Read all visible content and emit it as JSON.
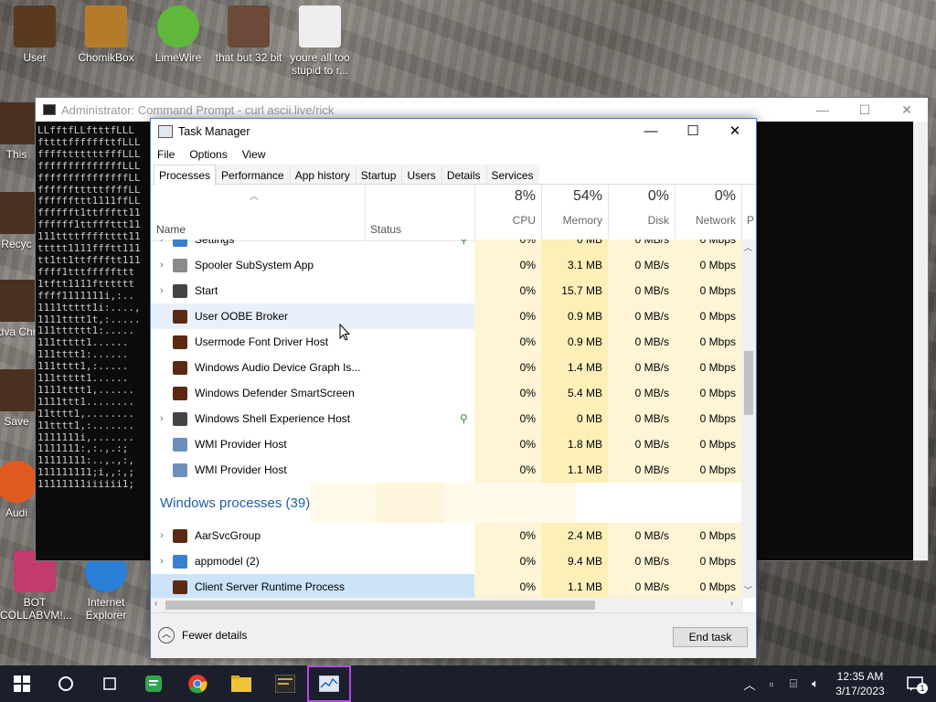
{
  "desktop": {
    "icons": [
      {
        "label": "User",
        "color": "#5a3a1e"
      },
      {
        "label": "ChomikBox",
        "color": "#b57b2a"
      },
      {
        "label": "LimeWire",
        "color": "#5fb83a"
      },
      {
        "label": "that but 32 bit",
        "color": "#6b4a3a"
      },
      {
        "label": "youre all too stupid to r...",
        "color": "#eeeeee"
      },
      {
        "label": "BOT COLLABVM!...",
        "color": "#c23a6e"
      },
      {
        "label": "Internet Explorer",
        "color": "#2a7fd6"
      }
    ],
    "left_partial_labels": [
      "This",
      "Recyc",
      "Adva Chro",
      "Save",
      "Audi"
    ]
  },
  "cmd": {
    "title": "Administrator: Command Prompt - curl ascii.live/rick",
    "lines": [
      "LLfftfLLftttfLLL",
      "fttttffffffttfLLL",
      "fffftttttttfffLLL",
      "ffffffffffffffLLL",
      "fffffffffffffffLL",
      "fffffftttttffffLL",
      "ffffffttt1111ffLL",
      "fffffft1ttffftt11",
      "ffffff1ttfffttt11",
      "111ttttfffftttt11",
      "ttttt1111ffftt111",
      "tt1tt1ttfffftt111",
      "ffff1tttfffffttt",
      "1tftt1111ftttttt",
      "ffff1111111i,:..",
      "1111ttttt1i:....,",
      "1111tttt1t,:.....",
      "111tttttt1:.....",
      "111ttttt1......",
      "111tttt1:......",
      "111tttt1,:.....",
      "111ttttt1......",
      "1111tttt1,......",
      "1111ttt1........",
      "11tttt1,........",
      "11tttt1,:.......",
      "1111111i,.......",
      "1111111:,:.,.:;",
      "11111111:..,.,:,",
      "111111111;i,,:,;",
      "11111111iiiiii1;"
    ],
    "controls": [
      "—",
      "☐",
      "✕"
    ]
  },
  "taskmanager": {
    "title": "Task Manager",
    "window_controls": [
      "—",
      "☐",
      "✕"
    ],
    "menu": [
      "File",
      "Options",
      "View"
    ],
    "tabs": [
      "Processes",
      "Performance",
      "App history",
      "Startup",
      "Users",
      "Details",
      "Services"
    ],
    "active_tab": "Processes",
    "columns": {
      "name": "Name",
      "status": "Status",
      "cpu": {
        "pct": "8%",
        "label": "CPU"
      },
      "memory": {
        "pct": "54%",
        "label": "Memory"
      },
      "disk": {
        "pct": "0%",
        "label": "Disk"
      },
      "network": {
        "pct": "0%",
        "label": "Network"
      },
      "power_partial": "P"
    },
    "rows": [
      {
        "expand": "›",
        "icon": "gear-icon",
        "name": "Settings",
        "leaf": true,
        "cpu": "0%",
        "mem": "0 MB",
        "disk": "0 MB/s",
        "net": "0 Mbps"
      },
      {
        "expand": "›",
        "icon": "printer-icon",
        "name": "Spooler SubSystem App",
        "leaf": false,
        "cpu": "0%",
        "mem": "3.1 MB",
        "disk": "0 MB/s",
        "net": "0 Mbps"
      },
      {
        "expand": "›",
        "icon": "window-icon",
        "name": "Start",
        "leaf": false,
        "cpu": "0%",
        "mem": "15.7 MB",
        "disk": "0 MB/s",
        "net": "0 Mbps"
      },
      {
        "expand": "",
        "icon": "app-icon",
        "name": "User OOBE Broker",
        "leaf": false,
        "cpu": "0%",
        "mem": "0.9 MB",
        "disk": "0 MB/s",
        "net": "0 Mbps"
      },
      {
        "expand": "",
        "icon": "app-icon",
        "name": "Usermode Font Driver Host",
        "leaf": false,
        "cpu": "0%",
        "mem": "0.9 MB",
        "disk": "0 MB/s",
        "net": "0 Mbps"
      },
      {
        "expand": "",
        "icon": "app-icon",
        "name": "Windows Audio Device Graph Is...",
        "leaf": false,
        "cpu": "0%",
        "mem": "1.4 MB",
        "disk": "0 MB/s",
        "net": "0 Mbps"
      },
      {
        "expand": "",
        "icon": "app-icon",
        "name": "Windows Defender SmartScreen",
        "leaf": false,
        "cpu": "0%",
        "mem": "5.4 MB",
        "disk": "0 MB/s",
        "net": "0 Mbps"
      },
      {
        "expand": "›",
        "icon": "window-icon",
        "name": "Windows Shell Experience Host",
        "leaf": true,
        "cpu": "0%",
        "mem": "0 MB",
        "disk": "0 MB/s",
        "net": "0 Mbps"
      },
      {
        "expand": "",
        "icon": "wmi-icon",
        "name": "WMI Provider Host",
        "leaf": false,
        "cpu": "0%",
        "mem": "1.8 MB",
        "disk": "0 MB/s",
        "net": "0 Mbps"
      },
      {
        "expand": "",
        "icon": "wmi-icon",
        "name": "WMI Provider Host",
        "leaf": false,
        "cpu": "0%",
        "mem": "1.1 MB",
        "disk": "0 MB/s",
        "net": "0 Mbps"
      }
    ],
    "group": "Windows processes (39)",
    "rows2": [
      {
        "expand": "›",
        "icon": "app-icon",
        "name": "AarSvcGroup",
        "cpu": "0%",
        "mem": "2.4 MB",
        "disk": "0 MB/s",
        "net": "0 Mbps"
      },
      {
        "expand": "›",
        "icon": "gear-icon",
        "name": "appmodel (2)",
        "cpu": "0%",
        "mem": "9.4 MB",
        "disk": "0 MB/s",
        "net": "0 Mbps"
      },
      {
        "expand": "",
        "icon": "app-icon",
        "name": "Client Server Runtime Process",
        "cpu": "0%",
        "mem": "1.1 MB",
        "disk": "0 MB/s",
        "net": "0 Mbps"
      }
    ],
    "footer": {
      "fewer_details": "Fewer details",
      "end_task": "End task"
    }
  },
  "taskbar": {
    "items": [
      "windows-start-icon",
      "search-icon",
      "task-view-icon",
      "notes-icon",
      "chrome-icon",
      "file-explorer-icon",
      "cmd-icon",
      "task-manager-icon"
    ],
    "clock_time": "12:35 AM",
    "clock_date": "3/17/2023",
    "notification_count": "1"
  }
}
